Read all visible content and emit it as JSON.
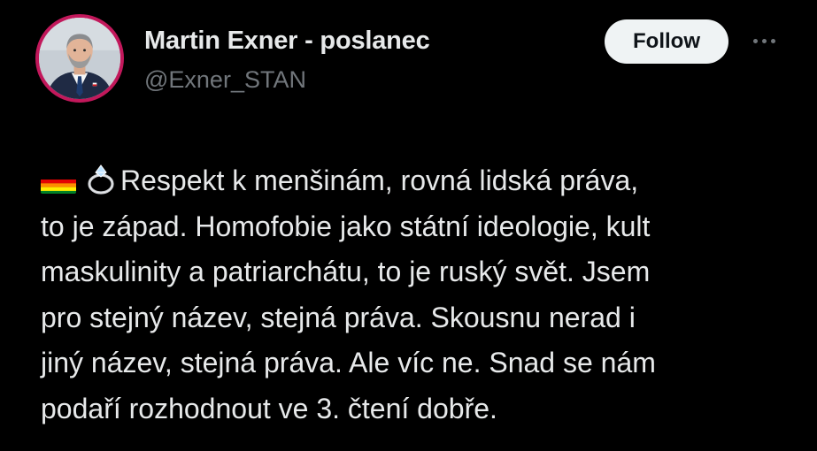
{
  "author": {
    "display_name": "Martin Exner - poslanec",
    "handle": "@Exner_STAN"
  },
  "actions": {
    "follow_label": "Follow"
  },
  "tweet": {
    "emojis": [
      "rainbow-flag",
      "ring"
    ],
    "lines": [
      "Respekt k menšinám, rovná lidská práva,",
      "to je západ. Homofobie jako státní ideologie, kult",
      "maskulinity a patriarchátu, to je ruský svět. Jsem",
      "pro stejný název, stejná práva. Skousnu nerad i",
      "jiný název, stejná práva. Ale víc ne. Snad se nám",
      "podaří rozhodnout ve 3. čtení dobře."
    ]
  },
  "colors": {
    "background": "#000000",
    "text_primary": "#e7e9ea",
    "text_secondary": "#71767b",
    "follow_button_bg": "#eff3f4",
    "avatar_ring": "#c2185b"
  }
}
